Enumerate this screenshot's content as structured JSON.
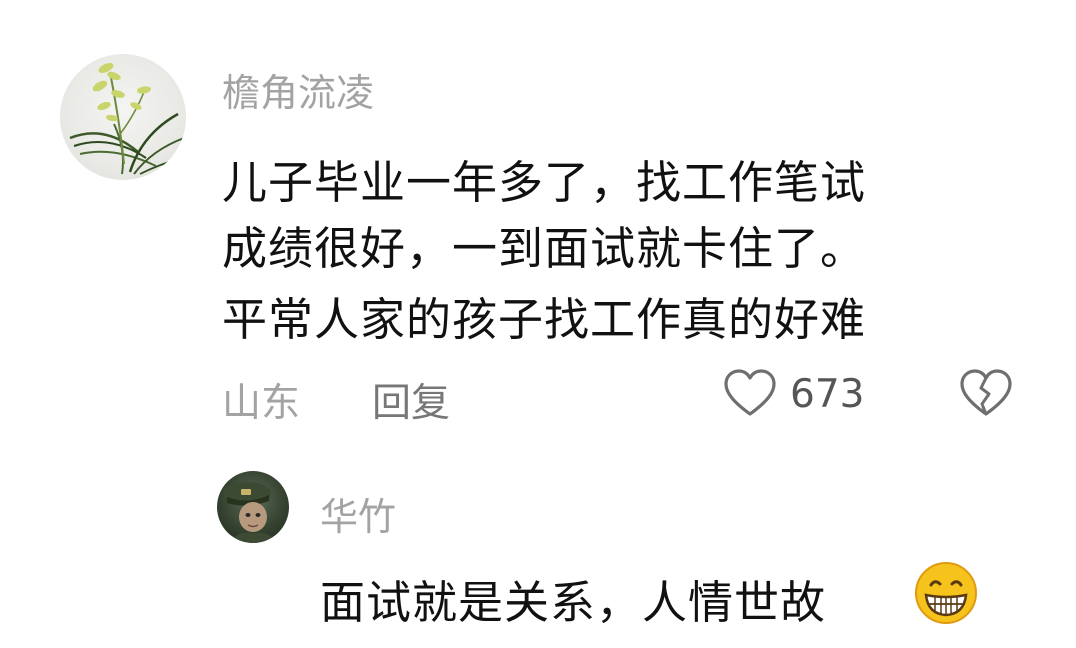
{
  "comment": {
    "username": "檐角流凌",
    "lines": [
      "儿子毕业一年多了，找工作笔试",
      "成绩很好，一到面试就卡住了。",
      "平常人家的孩子找工作真的好难"
    ],
    "location": "山东",
    "reply_label": "回复",
    "like_count": "673",
    "like_icon": "heart-outline-icon",
    "dislike_icon": "broken-heart-icon",
    "avatar": "orchid-plant-avatar"
  },
  "reply": {
    "username": "华竹",
    "text": "面试就是关系，人情世故",
    "emoji": "grinning-face-emoji",
    "avatar": "soldier-cap-avatar"
  },
  "colors": {
    "meta_gray": "#a3a3a3",
    "text": "#111111",
    "emoji_yellow": "#f6c21c"
  }
}
